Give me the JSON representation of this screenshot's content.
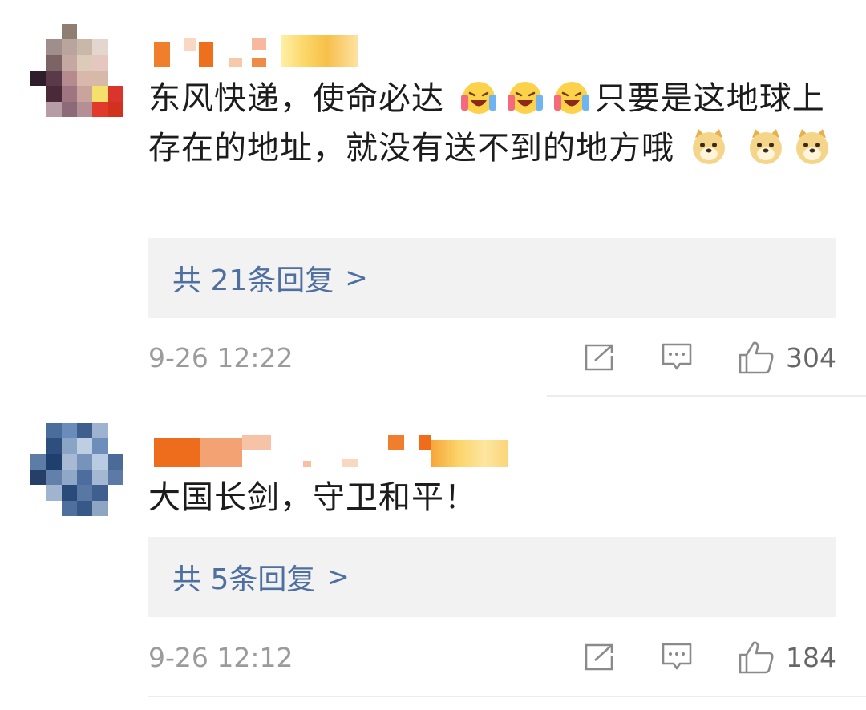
{
  "comments": [
    {
      "text_part1": "东风快递，使命必达",
      "text_part2": "只要是这地球上存在的地址，就没有送不到的地方哦",
      "replies_label": "共 21条回复",
      "replies_chevron": ">",
      "timestamp": "9-26 12:22",
      "like_count": "304",
      "emoji_after_part1": [
        "laugh-cry-emoji",
        "laugh-cry-emoji",
        "laugh-cry-emoji"
      ],
      "emoji_after_part2": [
        "doge-emoji",
        "doge-emoji",
        "doge-emoji"
      ]
    },
    {
      "text": "大国长剑，守卫和平！",
      "replies_label": "共 5条回复",
      "replies_chevron": ">",
      "timestamp": "9-26 12:12",
      "like_count": "184"
    }
  ],
  "icons": {
    "share": "share-icon",
    "reply": "comment-icon",
    "like": "thumbs-up-icon"
  },
  "colors": {
    "link": "#4e6fa0",
    "reply_bg": "#f2f2f2",
    "text": "#1c1c1c",
    "meta": "#9b9b9b"
  }
}
